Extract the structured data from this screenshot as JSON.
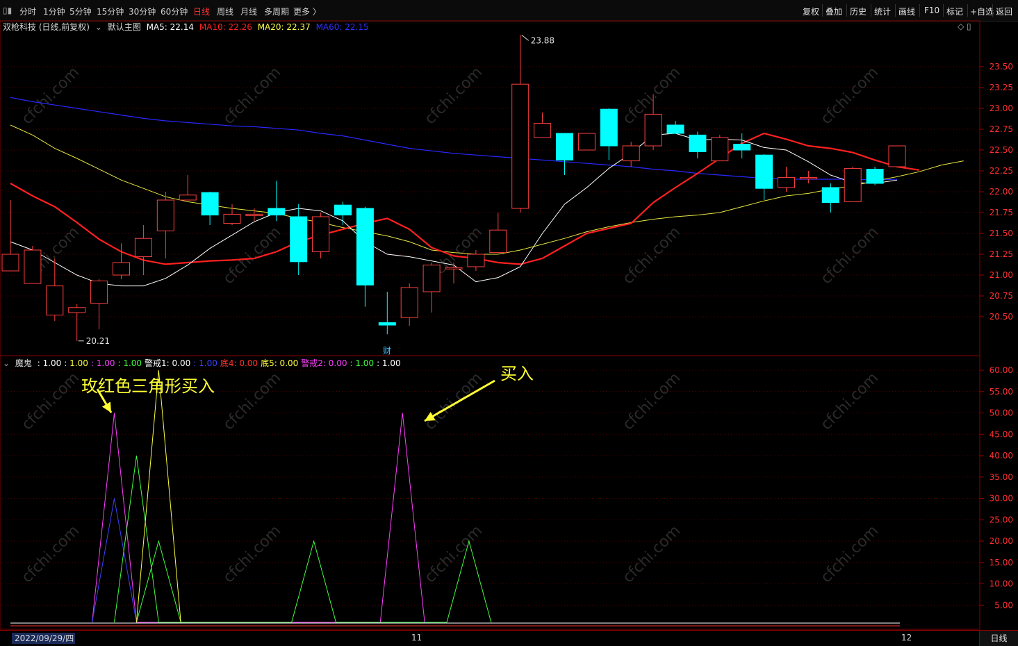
{
  "toolbar": {
    "left_items": [
      "分时",
      "1分钟",
      "5分钟",
      "15分钟",
      "30分钟",
      "60分钟",
      "日线",
      "周线",
      "月线",
      "多周期",
      "更多 〉"
    ],
    "active": "日线",
    "right_items": [
      "复权",
      "叠加",
      "历史",
      "统计",
      "画线",
      "F10",
      "标记",
      "+自选",
      "返回"
    ]
  },
  "main_legend": {
    "stock": "双枪科技 (日线,前复权)",
    "template": "默认主图",
    "ma5": "MA5: 22.14",
    "ma10": "MA10: 22.26",
    "ma20": "MA20: 22.37",
    "ma60": "MA60: 22.15",
    "colors": {
      "ma5": "#ffffff",
      "ma10": "#ff2020",
      "ma20": "#ffff40",
      "ma60": "#2020ff"
    }
  },
  "main_axis": [
    "23.50",
    "23.25",
    "23.00",
    "22.75",
    "22.50",
    "22.25",
    "22.00",
    "21.75",
    "21.50",
    "21.25",
    "21.00",
    "20.75",
    "20.50"
  ],
  "annotations": {
    "high": "23.88",
    "low": "20.21",
    "event": "财"
  },
  "sub_legend": {
    "name": "魔鬼",
    "items": [
      {
        "text": ": 1.00",
        "color": "#ffffff"
      },
      {
        "text": ": 1.00",
        "color": "#ffff40"
      },
      {
        "text": ": 1.00",
        "color": "#ff40ff"
      },
      {
        "text": ": 1.00",
        "color": "#40ff40"
      },
      {
        "text": "警戒1: 0.00",
        "color": "#ffffff"
      },
      {
        "text": ": 1.00",
        "color": "#4040ff"
      },
      {
        "text": "底4: 0.00",
        "color": "#ff3030"
      },
      {
        "text": "底5: 0.00",
        "color": "#ffff40"
      },
      {
        "text": "警戒2: 0.00",
        "color": "#ff40ff"
      },
      {
        "text": ": 1.00",
        "color": "#40ff40"
      },
      {
        "text": ": 1.00",
        "color": "#ffffff"
      }
    ]
  },
  "sub_axis": [
    "60.00",
    "55.00",
    "50.00",
    "45.00",
    "40.00",
    "35.00",
    "30.00",
    "25.00",
    "20.00",
    "15.00",
    "10.00",
    "5.00"
  ],
  "callouts": {
    "left": "玫红色三角形买入",
    "right": "买入"
  },
  "bottom": {
    "date": "2022/09/29/四",
    "tick_nov": "11",
    "tick_dec": "12",
    "period_button": "日线"
  },
  "watermark": "cfchi.com",
  "candles": [
    {
      "o": 21.05,
      "c": 21.25,
      "h": 21.9,
      "l": 21.05
    },
    {
      "o": 20.9,
      "c": 21.3,
      "h": 21.35,
      "l": 20.9
    },
    {
      "o": 20.52,
      "c": 20.87,
      "h": 21.2,
      "l": 20.45
    },
    {
      "o": 20.55,
      "c": 20.61,
      "h": 20.65,
      "l": 20.21
    },
    {
      "o": 20.66,
      "c": 20.93,
      "h": 20.95,
      "l": 20.35
    },
    {
      "o": 21.0,
      "c": 21.15,
      "h": 21.38,
      "l": 20.95
    },
    {
      "o": 21.22,
      "c": 21.44,
      "h": 21.6,
      "l": 21.0
    },
    {
      "o": 21.53,
      "c": 21.9,
      "h": 22.0,
      "l": 21.2
    },
    {
      "o": 21.9,
      "c": 21.96,
      "h": 22.2,
      "l": 21.9
    },
    {
      "o": 21.99,
      "c": 21.72,
      "h": 22.0,
      "l": 21.6
    },
    {
      "o": 21.62,
      "c": 21.73,
      "h": 21.85,
      "l": 21.6
    },
    {
      "o": 21.72,
      "c": 21.73,
      "h": 21.8,
      "l": 21.65
    },
    {
      "o": 21.8,
      "c": 21.72,
      "h": 22.13,
      "l": 21.65
    },
    {
      "o": 21.7,
      "c": 21.16,
      "h": 21.85,
      "l": 21.0
    },
    {
      "o": 21.28,
      "c": 21.7,
      "h": 21.75,
      "l": 21.2
    },
    {
      "o": 21.84,
      "c": 21.72,
      "h": 21.88,
      "l": 21.6
    },
    {
      "o": 21.8,
      "c": 20.88,
      "h": 21.82,
      "l": 20.62
    },
    {
      "o": 20.43,
      "c": 20.4,
      "h": 20.8,
      "l": 20.29
    },
    {
      "o": 20.49,
      "c": 20.85,
      "h": 20.9,
      "l": 20.39
    },
    {
      "o": 20.8,
      "c": 21.12,
      "h": 21.15,
      "l": 20.55
    },
    {
      "o": 21.09,
      "c": 21.09,
      "h": 21.15,
      "l": 20.9
    },
    {
      "o": 21.1,
      "c": 21.25,
      "h": 21.3,
      "l": 21.05
    },
    {
      "o": 21.27,
      "c": 21.54,
      "h": 21.75,
      "l": 21.27
    },
    {
      "o": 21.8,
      "c": 23.29,
      "h": 23.88,
      "l": 21.75
    },
    {
      "o": 22.65,
      "c": 22.82,
      "h": 22.95,
      "l": 22.65
    },
    {
      "o": 22.7,
      "c": 22.38,
      "h": 22.7,
      "l": 22.2
    },
    {
      "o": 22.5,
      "c": 22.7,
      "h": 22.7,
      "l": 22.5
    },
    {
      "o": 22.99,
      "c": 22.55,
      "h": 23.0,
      "l": 22.38
    },
    {
      "o": 22.37,
      "c": 22.55,
      "h": 22.6,
      "l": 22.3
    },
    {
      "o": 22.55,
      "c": 22.93,
      "h": 23.17,
      "l": 22.5
    },
    {
      "o": 22.8,
      "c": 22.7,
      "h": 22.85,
      "l": 22.7
    },
    {
      "o": 22.68,
      "c": 22.48,
      "h": 22.72,
      "l": 22.4
    },
    {
      "o": 22.37,
      "c": 22.65,
      "h": 22.68,
      "l": 22.37
    },
    {
      "o": 22.57,
      "c": 22.5,
      "h": 22.7,
      "l": 22.4
    },
    {
      "o": 22.44,
      "c": 22.04,
      "h": 22.45,
      "l": 21.9
    },
    {
      "o": 22.05,
      "c": 22.17,
      "h": 22.3,
      "l": 22.0
    },
    {
      "o": 22.17,
      "c": 22.17,
      "h": 22.25,
      "l": 22.1
    },
    {
      "o": 22.05,
      "c": 21.87,
      "h": 22.1,
      "l": 21.75
    },
    {
      "o": 21.88,
      "c": 22.28,
      "h": 22.3,
      "l": 21.88
    },
    {
      "o": 22.27,
      "c": 22.1,
      "h": 22.3,
      "l": 22.08
    },
    {
      "o": 22.3,
      "c": 22.55,
      "h": 22.55,
      "l": 22.3
    }
  ],
  "ma5_vals": [
    21.4,
    21.3,
    21.15,
    21.0,
    20.9,
    20.87,
    20.87,
    20.96,
    21.12,
    21.32,
    21.48,
    21.64,
    21.75,
    21.8,
    21.77,
    21.65,
    21.4,
    21.25,
    21.22,
    21.17,
    21.12,
    20.92,
    20.97,
    21.1,
    21.5,
    21.85,
    22.05,
    22.28,
    22.46,
    22.68,
    22.7,
    22.62,
    22.63,
    22.62,
    22.53,
    22.5,
    22.36,
    22.2,
    22.11,
    22.1,
    22.14
  ],
  "ma10_vals": [
    22.1,
    21.95,
    21.82,
    21.63,
    21.43,
    21.28,
    21.18,
    21.13,
    21.15,
    21.17,
    21.18,
    21.2,
    21.28,
    21.4,
    21.48,
    21.55,
    21.62,
    21.68,
    21.55,
    21.33,
    21.23,
    21.2,
    21.15,
    21.13,
    21.2,
    21.35,
    21.5,
    21.56,
    21.62,
    21.87,
    22.05,
    22.22,
    22.4,
    22.58,
    22.7,
    22.63,
    22.55,
    22.52,
    22.47,
    22.38,
    22.3,
    22.26
  ],
  "ma20_vals": [
    22.8,
    22.68,
    22.52,
    22.4,
    22.27,
    22.14,
    22.04,
    21.94,
    21.88,
    21.84,
    21.8,
    21.77,
    21.74,
    21.68,
    21.63,
    21.57,
    21.52,
    21.47,
    21.4,
    21.3,
    21.27,
    21.25,
    21.25,
    21.3,
    21.37,
    21.44,
    21.52,
    21.58,
    21.63,
    21.67,
    21.7,
    21.72,
    21.75,
    21.82,
    21.89,
    21.95,
    21.98,
    22.03,
    22.07,
    22.13,
    22.18,
    22.24,
    22.32,
    22.37
  ],
  "ma60_vals": [
    23.13,
    23.08,
    23.04,
    23.0,
    22.96,
    22.92,
    22.88,
    22.85,
    22.83,
    22.81,
    22.79,
    22.78,
    22.76,
    22.74,
    22.7,
    22.67,
    22.62,
    22.57,
    22.52,
    22.49,
    22.46,
    22.44,
    22.42,
    22.4,
    22.38,
    22.36,
    22.34,
    22.32,
    22.3,
    22.27,
    22.25,
    22.22,
    22.2,
    22.18,
    22.16,
    22.15,
    22.15,
    22.15,
    22.15,
    22.14,
    22.15
  ],
  "sub_lines": [
    {
      "color": "#ff40ff",
      "pts": [
        [
          4,
          1
        ],
        [
          5,
          50
        ],
        [
          6,
          1
        ],
        [
          17,
          1
        ],
        [
          18,
          50
        ],
        [
          19,
          1
        ]
      ]
    },
    {
      "color": "#4040ff",
      "pts": [
        [
          4,
          1
        ],
        [
          5,
          30
        ],
        [
          6,
          1
        ]
      ]
    },
    {
      "color": "#40ff40",
      "pts": [
        [
          5,
          1
        ],
        [
          6,
          40
        ],
        [
          7,
          1
        ],
        [
          13,
          1
        ],
        [
          14,
          20
        ],
        [
          15,
          1
        ],
        [
          20,
          1
        ],
        [
          21,
          20
        ],
        [
          22,
          1
        ]
      ]
    },
    {
      "color": "#40ff40",
      "pts": [
        [
          6,
          1
        ],
        [
          7,
          20
        ],
        [
          8,
          1
        ]
      ]
    },
    {
      "color": "#ffff40",
      "pts": [
        [
          6,
          1
        ],
        [
          7,
          60
        ],
        [
          8,
          1
        ]
      ]
    }
  ]
}
